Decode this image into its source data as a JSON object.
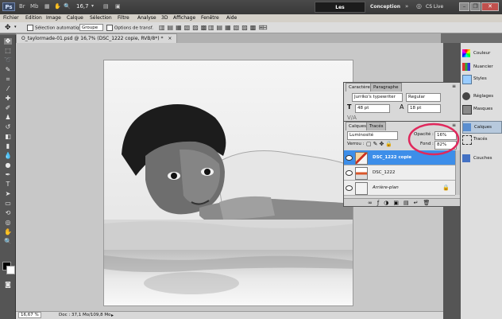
{
  "topbar": {
    "logo": "Ps",
    "zoom": "16,7",
    "workspaces": [
      "Les indispensables",
      "Conception"
    ],
    "cs_live": "CS Live"
  },
  "menu": [
    "Fichier",
    "Edition",
    "Image",
    "Calque",
    "Sélection",
    "Filtre",
    "Analyse",
    "3D",
    "Affichage",
    "Fenêtre",
    "Aide"
  ],
  "options": {
    "auto_select": "Sélection automatique :",
    "group": "Groupe",
    "transform": "Options de transf."
  },
  "document": {
    "tab": "O_taylormade-01.psd @ 16,7% (DSC_1222 copie, RVB/8*) *"
  },
  "status": {
    "zoom": "16,67 %",
    "doc": "Doc : 37,1 Mo/109,8 Mo"
  },
  "char_panel": {
    "tabs": [
      "Caractère",
      "Paragraphe"
    ],
    "font": "Jurriko's typewriter",
    "style": "Regular",
    "size": "48 pt",
    "leading": "18 pt"
  },
  "layers_panel": {
    "tabs": [
      "Calques",
      "Tracés"
    ],
    "blend_mode": "Luminosité",
    "opacity_label": "Opacité :",
    "opacity": "16%",
    "lock_label": "Verrou :",
    "fill_label": "Fond :",
    "fill": "82%",
    "layers": [
      "DSC_1222 copie",
      "DSC_1222",
      "Arrière-plan"
    ]
  },
  "dock": [
    "Couleur",
    "Nuancier",
    "Styles",
    "Réglages",
    "Masques",
    "Calques",
    "Tracés",
    "Couches"
  ],
  "colors": {
    "accent": "#3d8ee9",
    "highlight_circle": "#e0285c"
  }
}
